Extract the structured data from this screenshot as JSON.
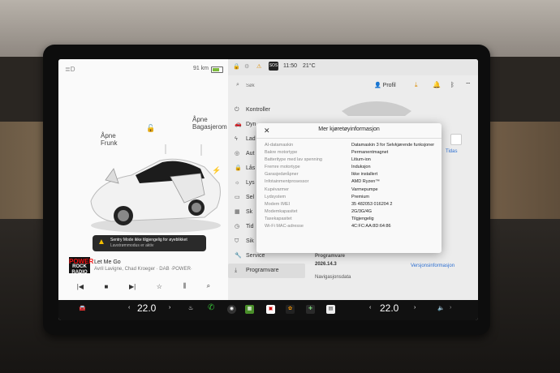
{
  "left_panel": {
    "range": "91 km",
    "frunk_label": "Åpne\nFrunk",
    "trunk_label": "Åpne\nBagasjerom",
    "sentry_title": "Sentry Mode ikke tilgjengelig for øyeblikket",
    "sentry_sub": "Lavstrømmodus er aktiv",
    "media": {
      "art_top": "POWER",
      "art_bottom": "ROCK RADIO",
      "song": "Let Me Go",
      "artist": "Avril Lavigne, Chad Kroeger · DAB ·POWER·"
    }
  },
  "status_bar": {
    "sos": "SOS",
    "time": "11:50",
    "temp": "21°C"
  },
  "search": {
    "placeholder": "Søk"
  },
  "profile": "Profil",
  "nav": {
    "items": [
      {
        "label": "Kontroller",
        "icon": "toggle-icon"
      },
      {
        "label": "Dyn",
        "icon": "car-icon"
      },
      {
        "label": "Lad",
        "icon": "bolt-icon"
      },
      {
        "label": "Aut",
        "icon": "steering-icon"
      },
      {
        "label": "Lås",
        "icon": "lock-icon"
      },
      {
        "label": "Lys",
        "icon": "light-icon"
      },
      {
        "label": "Sel",
        "icon": "display-icon"
      },
      {
        "label": "Sk",
        "icon": "calendar-icon"
      },
      {
        "label": "Tid",
        "icon": "clock-icon"
      },
      {
        "label": "Sik",
        "icon": "shield-icon"
      },
      {
        "label": "Service",
        "icon": "wrench-icon"
      },
      {
        "label": "Programvare",
        "icon": "download-icon"
      }
    ]
  },
  "content": {
    "tidas": "Tidas",
    "software_label": "Programvare",
    "software_version": "2026.14.3",
    "release_notes_link": "Versjonsinformasjon",
    "nav_data": "Navigasjonsdata"
  },
  "modal": {
    "title": "Mer kjøretøyinformasjon",
    "rows": [
      {
        "k": "AI-datamaskin",
        "v": "Datamaskin 3 for Selvkjørende funksjoner"
      },
      {
        "k": "Bakre motortype",
        "v": "Permanentmagnet"
      },
      {
        "k": "Batteritype med lav spenning",
        "v": "Litium-ion"
      },
      {
        "k": "Fremre motortype",
        "v": "Induksjon"
      },
      {
        "k": "Garasjedøråpner",
        "v": "Ikke installert"
      },
      {
        "k": "Infotainmentprosessor",
        "v": "AMD Ryzen™"
      },
      {
        "k": "Kupévarmer",
        "v": "Varmepumpe"
      },
      {
        "k": "Lydsystem",
        "v": "Premium"
      },
      {
        "k": "Modem IMEI",
        "v": "35 482053 016204 2"
      },
      {
        "k": "Modemkapasitet",
        "v": "2G/3G/4G"
      },
      {
        "k": "Taxekapasitet",
        "v": "Tilgjengelig"
      },
      {
        "k": "Wi-Fi MAC-adresse",
        "v": "4C:FC:AA:8D:64:86"
      }
    ]
  },
  "taskbar": {
    "driver_temp": "22.0",
    "passenger_temp": "22.0"
  },
  "colors": {
    "accent": "#2d6fd1",
    "warning": "#f6c000",
    "battery": "#7dbb3c"
  }
}
